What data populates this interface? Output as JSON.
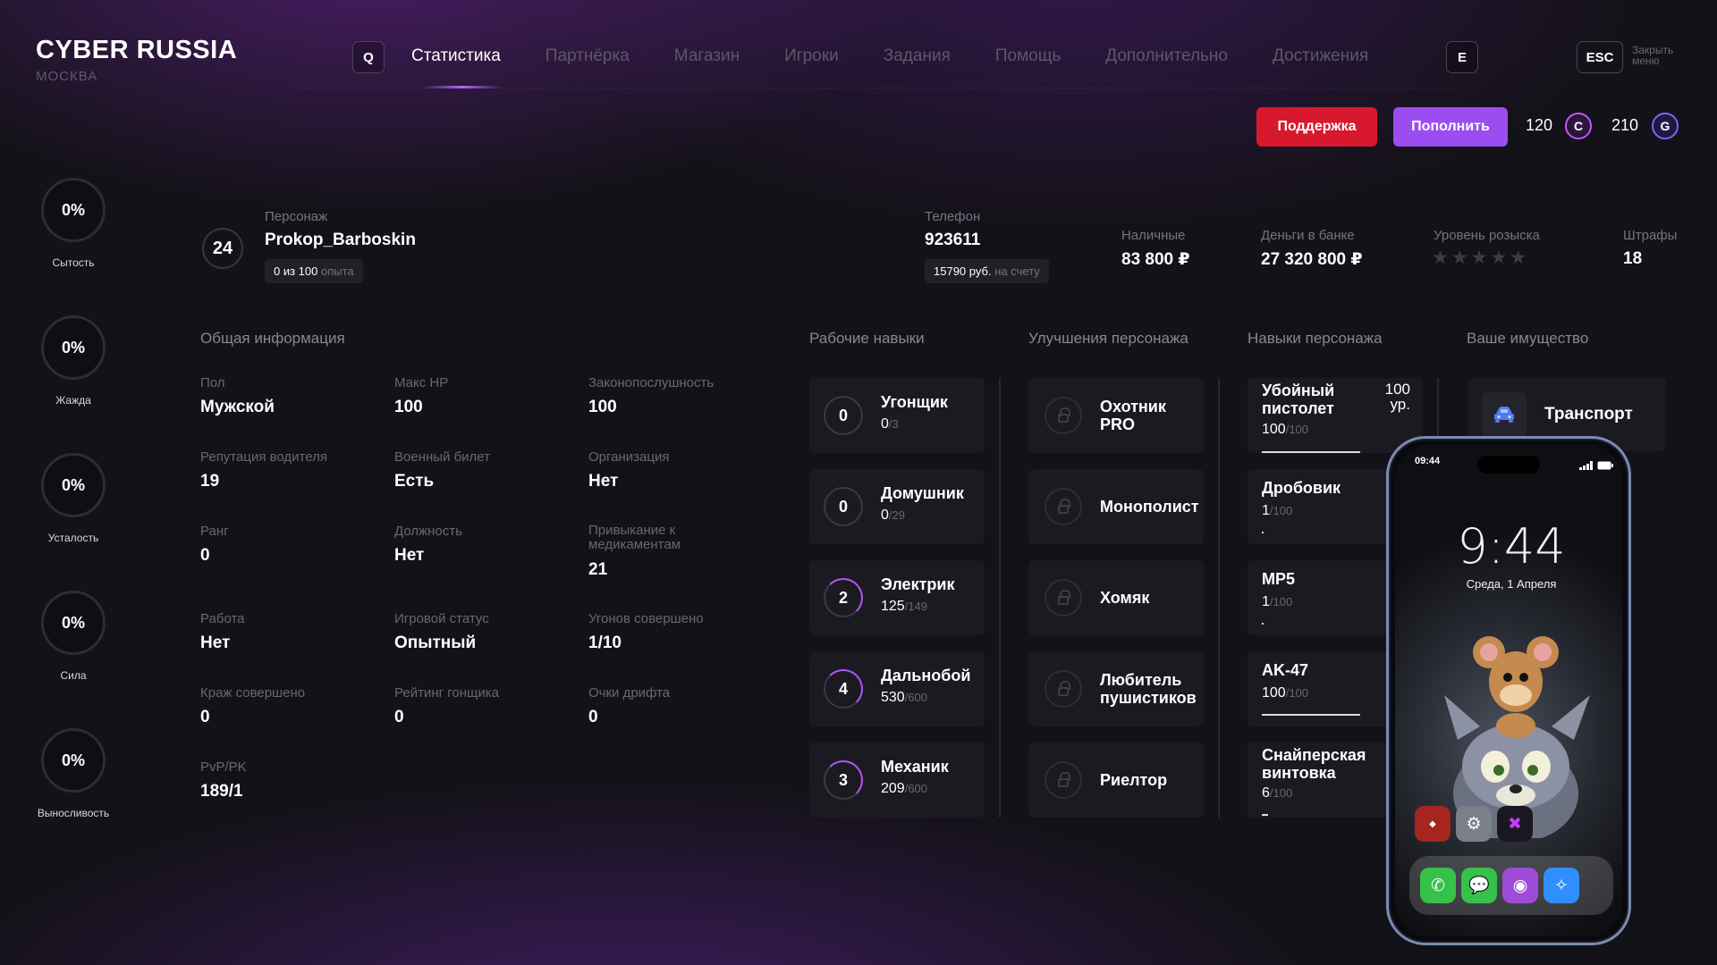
{
  "brand": {
    "title": "CYBER RUSSIA",
    "city": "МОСКВА"
  },
  "nav": {
    "key_left": "Q",
    "key_right": "E",
    "tabs": [
      "Статистика",
      "Партнёрка",
      "Магазин",
      "Игроки",
      "Задания",
      "Помощь",
      "Дополнительно",
      "Достижения"
    ],
    "active_tab": "Статистика",
    "esc_key": "ESC",
    "esc_label_1": "Закрыть",
    "esc_label_2": "меню"
  },
  "actions": {
    "support": "Поддержка",
    "topup": "Пополнить",
    "currency_c_amount": "120",
    "currency_c_icon": "C",
    "currency_g_amount": "210",
    "currency_g_icon": "G"
  },
  "needs": [
    {
      "value": "0%",
      "label": "Сытость"
    },
    {
      "value": "0%",
      "label": "Жажда"
    },
    {
      "value": "0%",
      "label": "Усталость"
    },
    {
      "value": "0%",
      "label": "Сила"
    },
    {
      "value": "0%",
      "label": "Выносливость"
    }
  ],
  "character": {
    "level": "24",
    "label": "Персонаж",
    "name": "Prokop_Barboskin",
    "exp_value": "0 из 100",
    "exp_unit": "опыта"
  },
  "phone_info": {
    "label": "Телефон",
    "number": "923611",
    "balance_value": "15790 руб.",
    "balance_unit": "на счету"
  },
  "money": {
    "cash_label": "Наличные",
    "cash": "83 800 ₽",
    "bank_label": "Деньги в банке",
    "bank": "27 320 800 ₽",
    "wanted_label": "Уровень розыска",
    "wanted_stars": "★★★★★",
    "wanted_level": 0,
    "fines_label": "Штрафы",
    "fines": "18"
  },
  "sections": {
    "general": "Общая информация",
    "work": "Рабочие навыки",
    "upgrades": "Улучшения персонажа",
    "skills": "Навыки персонажа",
    "property": "Ваше имущество"
  },
  "general_info": [
    {
      "label": "Пол",
      "value": "Мужской"
    },
    {
      "label": "Макс HP",
      "value": "100"
    },
    {
      "label": "Законопослушность",
      "value": "100"
    },
    {
      "label": "Репутация водителя",
      "value": "19"
    },
    {
      "label": "Военный билет",
      "value": "Есть"
    },
    {
      "label": "Организация",
      "value": "Нет"
    },
    {
      "label": "Ранг",
      "value": "0"
    },
    {
      "label": "Должность",
      "value": "Нет"
    },
    {
      "label": "Привыкание к медикаментам",
      "value": "21"
    },
    {
      "label": "Работа",
      "value": "Нет"
    },
    {
      "label": "Игровой статус",
      "value": "Опытный"
    },
    {
      "label": "Угонов совершено",
      "value": "1/10"
    },
    {
      "label": "Краж совершено",
      "value": "0"
    },
    {
      "label": "Рейтинг гонщика",
      "value": "0"
    },
    {
      "label": "Очки дрифта",
      "value": "0"
    },
    {
      "label": "PvP/PK",
      "value": "189/1"
    }
  ],
  "work_skills": [
    {
      "level": "0",
      "name": "Угонщик",
      "current": "0",
      "max": "/3"
    },
    {
      "level": "0",
      "name": "Домушник",
      "current": "0",
      "max": "/29"
    },
    {
      "level": "2",
      "name": "Электрик",
      "current": "125",
      "max": "/149"
    },
    {
      "level": "4",
      "name": "Дальнобой",
      "current": "530",
      "max": "/600"
    },
    {
      "level": "3",
      "name": "Механик",
      "current": "209",
      "max": "/600"
    }
  ],
  "upgrades": [
    {
      "name_1": "Охотник",
      "name_2": "PRO"
    },
    {
      "name_1": "Монополист",
      "name_2": ""
    },
    {
      "name_1": "Хомяк",
      "name_2": ""
    },
    {
      "name_1": "Любитель",
      "name_2": "пушистиков"
    },
    {
      "name_1": "Риелтор",
      "name_2": ""
    }
  ],
  "weapon_skills": [
    {
      "name_1": "Убойный",
      "name_2": "пистолет",
      "lvl_1": "100",
      "lvl_2": "ур.",
      "current": "100",
      "max": "/100",
      "progress": 1.0
    },
    {
      "name_1": "Дробовик",
      "name_2": "",
      "lvl_1": "1",
      "lvl_2": "",
      "current": "1",
      "max": "/100",
      "progress": 0.01
    },
    {
      "name_1": "MP5",
      "name_2": "",
      "lvl_1": "1",
      "lvl_2": "",
      "current": "1",
      "max": "/100",
      "progress": 0.01
    },
    {
      "name_1": "AK-47",
      "name_2": "",
      "lvl_1": "100",
      "lvl_2": "",
      "current": "100",
      "max": "/100",
      "progress": 1.0
    },
    {
      "name_1": "Снайперская",
      "name_2": "винтовка",
      "lvl_1": "",
      "lvl_2": "",
      "current": "6",
      "max": "/100",
      "progress": 0.06
    }
  ],
  "property": {
    "transport": "Транспорт"
  },
  "phone": {
    "status_time": "09:44",
    "clock": "9:44",
    "date": "Среда, 1 Апреля"
  }
}
